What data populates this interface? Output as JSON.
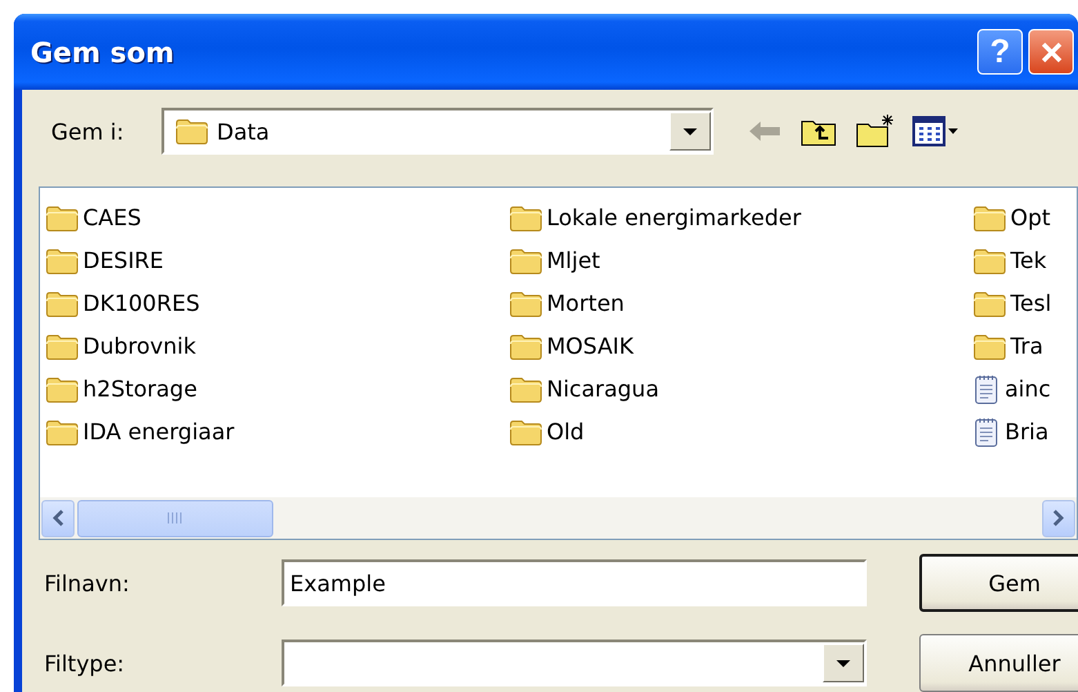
{
  "window": {
    "title": "Gem som",
    "help_button": "?"
  },
  "save_in": {
    "label": "Gem i:",
    "value": "Data"
  },
  "files": [
    {
      "name": "CAES",
      "kind": "folder"
    },
    {
      "name": "DESIRE",
      "kind": "folder"
    },
    {
      "name": "DK100RES",
      "kind": "folder"
    },
    {
      "name": "Dubrovnik",
      "kind": "folder"
    },
    {
      "name": "h2Storage",
      "kind": "folder"
    },
    {
      "name": "IDA energiaar",
      "kind": "folder"
    },
    {
      "name": "Lokale energimarkeder",
      "kind": "folder"
    },
    {
      "name": "Mljet",
      "kind": "folder"
    },
    {
      "name": "Morten",
      "kind": "folder"
    },
    {
      "name": "MOSAIK",
      "kind": "folder"
    },
    {
      "name": "Nicaragua",
      "kind": "folder"
    },
    {
      "name": "Old",
      "kind": "folder"
    },
    {
      "name": "Opt",
      "kind": "folder"
    },
    {
      "name": "Tek",
      "kind": "folder"
    },
    {
      "name": "Tesl",
      "kind": "folder"
    },
    {
      "name": "Tra",
      "kind": "folder"
    },
    {
      "name": "ainc",
      "kind": "file"
    },
    {
      "name": "Bria",
      "kind": "file"
    }
  ],
  "file_name": {
    "label": "Filnavn:",
    "value": "Example"
  },
  "file_type": {
    "label": "Filtype:"
  },
  "buttons": [
    {
      "label": "Gem",
      "default": true
    },
    {
      "label": "Annuller",
      "default": false
    }
  ]
}
